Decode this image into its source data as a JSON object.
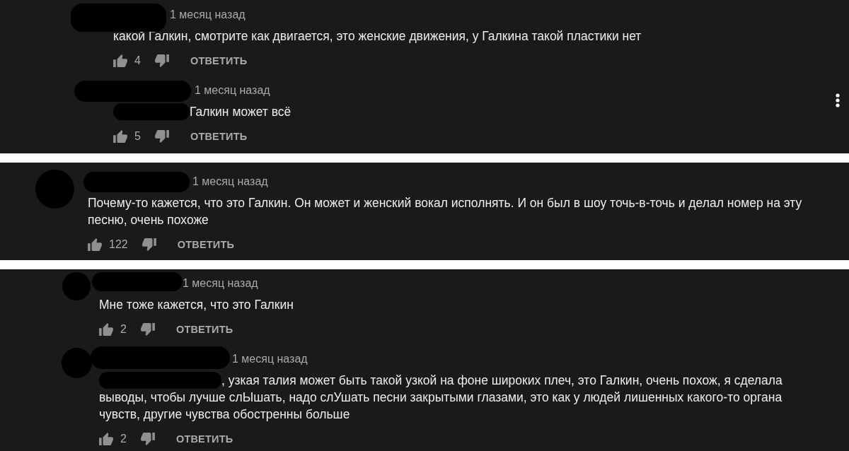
{
  "panels": [
    {
      "comments": [
        {
          "avatar": false,
          "mention": false,
          "menu": false,
          "time": "1 месяц назад",
          "text": "какой Галкин, смотрите как двигается, это женские движения, у Галкина такой пластики нет",
          "likes": "4",
          "reply": "ОТВЕТИТЬ"
        },
        {
          "avatar": false,
          "mention": true,
          "menu": true,
          "time": "1 месяц назад",
          "text": "Галкин может всё",
          "likes": "5",
          "reply": "ОТВЕТИТЬ"
        }
      ]
    },
    {
      "comments": [
        {
          "avatar": true,
          "mention": false,
          "menu": false,
          "time": "1 месяц назад",
          "text": "Почему-то кажется, что это Галкин. Он может и женский вокал исполнять. И он был в шоу точь-в-точь и делал номер на эту песню, очень похоже",
          "likes": "122",
          "reply": "ОТВЕТИТЬ"
        }
      ]
    },
    {
      "comments": [
        {
          "avatar": true,
          "mention": false,
          "menu": false,
          "time": "1 месяц назад",
          "text": "Мне тоже кажется, что это Галкин",
          "likes": "2",
          "reply": "ОТВЕТИТЬ"
        },
        {
          "avatar": true,
          "mention": true,
          "menu": false,
          "time": "1 месяц назад",
          "text": ", узкая талия может быть такой узкой на фоне широких плеч, это Галкин, очень похож, я сделала выводы, чтобы лучше слЫшать, надо слУшать песни закрытыми глазами, это как у людей лишенных какого-то органа чувств, другие чувства обостренны больше",
          "likes": "2",
          "reply": "ОТВЕТИТЬ"
        }
      ]
    }
  ]
}
